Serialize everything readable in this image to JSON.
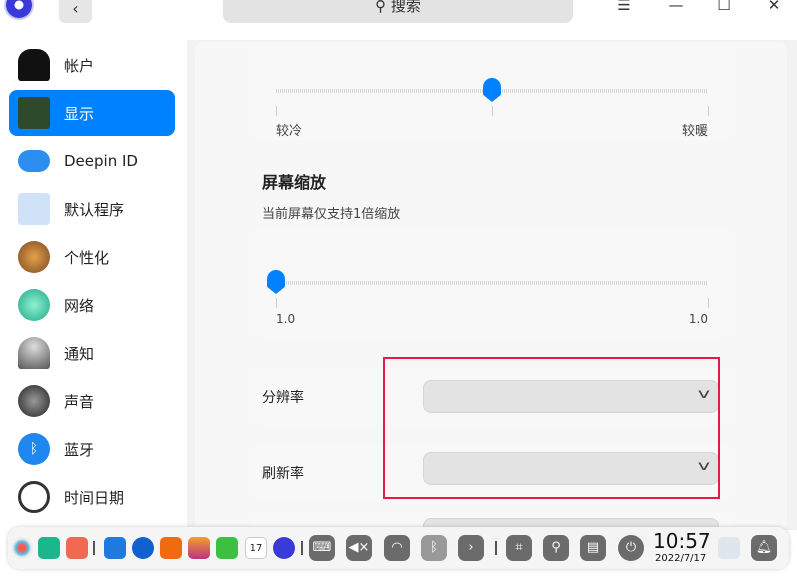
{
  "titlebar": {
    "search_placeholder": "搜索",
    "back": "‹"
  },
  "sidebar": {
    "items": [
      {
        "label": "帐户"
      },
      {
        "label": "显示"
      },
      {
        "label": "Deepin ID"
      },
      {
        "label": "默认程序"
      },
      {
        "label": "个性化"
      },
      {
        "label": "网络"
      },
      {
        "label": "通知"
      },
      {
        "label": "声音"
      },
      {
        "label": "蓝牙"
      },
      {
        "label": "时间日期"
      }
    ],
    "selected": "显示"
  },
  "color_temp": {
    "min_label": "较冷",
    "max_label": "较暖",
    "value_fraction": 0.5
  },
  "scaling": {
    "title": "屏幕缩放",
    "subtitle": "当前屏幕仅支持1倍缩放",
    "min_label": "1.0",
    "max_label": "1.0",
    "value_fraction": 0
  },
  "resolution": {
    "label": "分辨率",
    "value": ""
  },
  "refresh_rate": {
    "label": "刷新率",
    "value": ""
  },
  "highlight_color": "#e8184a",
  "accent": "#0081ff",
  "dock": {
    "time": "10:57",
    "date": "2022/7/17",
    "calendar_day": "17"
  }
}
